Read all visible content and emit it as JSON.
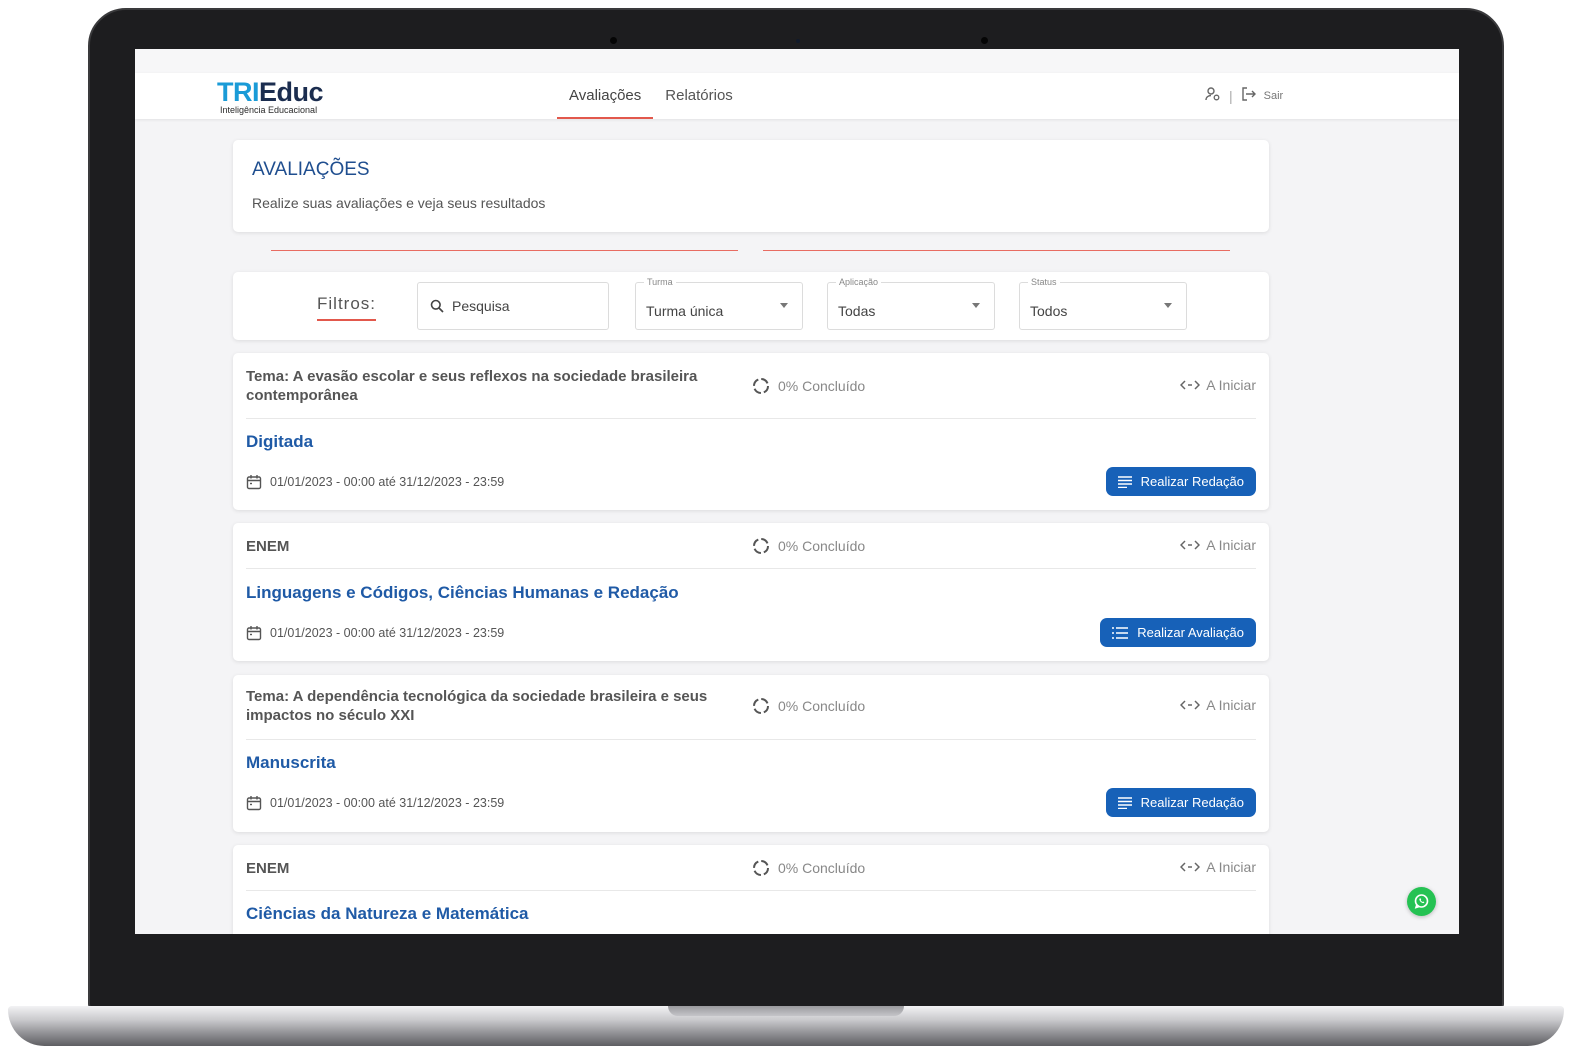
{
  "header": {
    "logo_tri": "TRI",
    "logo_educ": "Educ",
    "logo_sub": "Inteligência Educacional",
    "nav": [
      {
        "label": "Avaliações",
        "active": true
      },
      {
        "label": "Relatórios",
        "active": false
      }
    ],
    "separator": "|",
    "logout_label": "Sair"
  },
  "page": {
    "title": "AVALIAÇÕES",
    "subtitle": "Realize suas avaliações e veja seus resultados"
  },
  "filters": {
    "label": "Filtros:",
    "search_placeholder": "Pesquisa",
    "turma": {
      "label": "Turma",
      "value": "Turma única"
    },
    "aplicacao": {
      "label": "Aplicação",
      "value": "Todas"
    },
    "status": {
      "label": "Status",
      "value": "Todos"
    }
  },
  "assessments": [
    {
      "theme": "Tema: A evasão escolar e seus reflexos na sociedade brasileira contemporânea",
      "progress": "0% Concluído",
      "status": "A Iniciar",
      "name": "Digitada",
      "dates": "01/01/2023 - 00:00 até 31/12/2023 - 23:59",
      "button": "Realizar Redação"
    },
    {
      "theme": "ENEM",
      "progress": "0% Concluído",
      "status": "A Iniciar",
      "name": "Linguagens e Códigos, Ciências Humanas e Redação",
      "dates": "01/01/2023 - 00:00 até 31/12/2023 - 23:59",
      "button": "Realizar Avaliação"
    },
    {
      "theme": "Tema: A dependência tecnológica da sociedade brasileira e seus impactos no século XXI",
      "progress": "0% Concluído",
      "status": "A Iniciar",
      "name": "Manuscrita",
      "dates": "01/01/2023 - 00:00 até 31/12/2023 - 23:59",
      "button": "Realizar Redação"
    },
    {
      "theme": "ENEM",
      "progress": "0% Concluído",
      "status": "A Iniciar",
      "name": "Ciências da Natureza e Matemática"
    }
  ],
  "colors": {
    "accent_red": "#e2584c",
    "primary_blue": "#1761b8",
    "title_blue": "#1f4e8f",
    "whatsapp_green": "#25c253"
  }
}
